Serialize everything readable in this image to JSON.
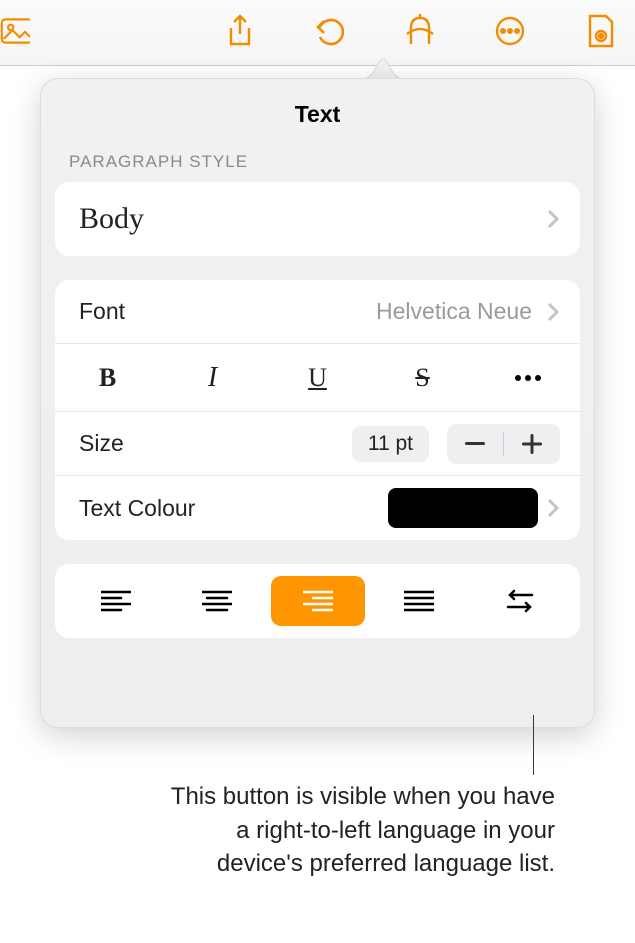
{
  "toolbar": {
    "icons": [
      "media-icon",
      "share-icon",
      "undo-icon",
      "format-icon",
      "more-icon",
      "document-view-icon"
    ]
  },
  "popover": {
    "title": "Text",
    "paragraph_style_label": "PARAGRAPH STYLE",
    "paragraph_style_value": "Body",
    "font_label": "Font",
    "font_value": "Helvetica Neue",
    "format_buttons": {
      "bold": "B",
      "italic": "I",
      "underline": "U",
      "strike": "S",
      "more": "more"
    },
    "size_label": "Size",
    "size_value": "11 pt",
    "text_colour_label": "Text Colour",
    "text_colour_value": "#000000",
    "alignment": {
      "options": [
        "left",
        "center",
        "right",
        "justify",
        "rtl"
      ],
      "selected": "right"
    }
  },
  "callout": "This button is visible when you have a right-to-left language in your device's preferred language list."
}
